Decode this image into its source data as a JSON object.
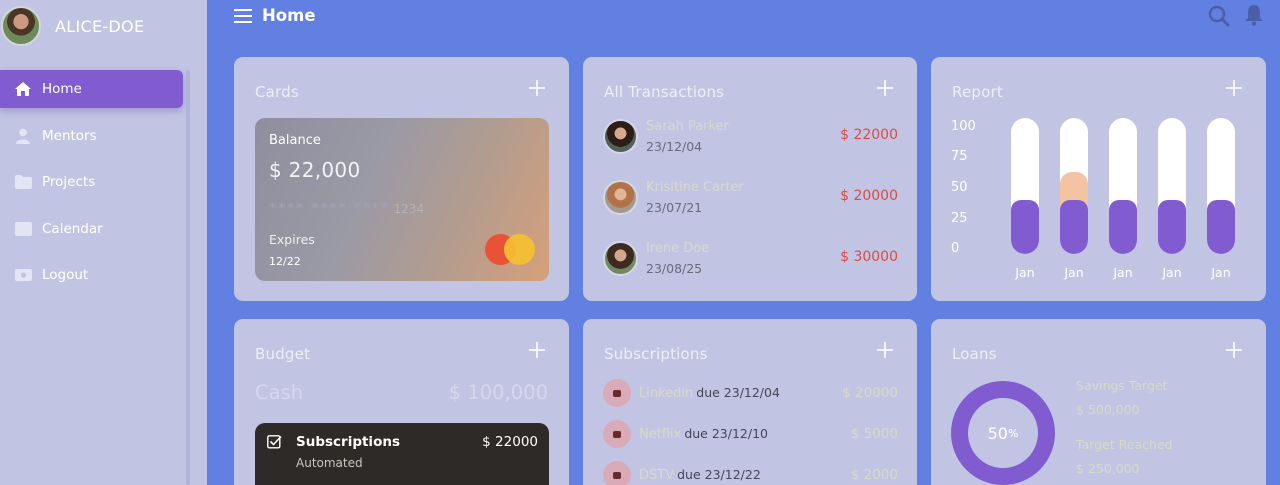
{
  "profile": {
    "username": "ALICE-DOE"
  },
  "nav": [
    {
      "label": "Home",
      "icon": "home-icon",
      "active": true
    },
    {
      "label": "Mentors",
      "icon": "user-icon"
    },
    {
      "label": "Projects",
      "icon": "folder-icon"
    },
    {
      "label": "Calendar",
      "icon": "calendar-icon"
    },
    {
      "label": "Logout",
      "icon": "logout-icon"
    }
  ],
  "topbar": {
    "title": "Home"
  },
  "cards_panel": {
    "title": "Cards",
    "balance_label": "Balance",
    "balance_value": "$ 22,000",
    "masked_number": "**** **** ****",
    "last_digits": "1234",
    "expires_label": "Expires",
    "expires_value": "12/22"
  },
  "transactions_panel": {
    "title": "All Transactions",
    "items": [
      {
        "name": "Sarah Parker",
        "date": "23/12/04",
        "amount": "$ 22000"
      },
      {
        "name": "Krisitine Carter",
        "date": "23/07/21",
        "amount": "$ 20000"
      },
      {
        "name": "Irene Doe",
        "date": "23/08/25",
        "amount": "$ 30000"
      }
    ]
  },
  "report_panel": {
    "title": "Report",
    "chart_data": {
      "type": "bar",
      "y_ticks": [
        "100",
        "75",
        "50",
        "25",
        "0"
      ],
      "categories": [
        "Jan",
        "Jan",
        "Jan",
        "Jan",
        "Jan"
      ],
      "values": [
        40,
        40,
        40,
        40,
        40
      ],
      "highlight_values": [
        0,
        60,
        0,
        0,
        0
      ],
      "ylim": [
        0,
        100
      ],
      "colors": {
        "fill": "#805cd0",
        "highlight": "#f3c3a4",
        "track": "#ffffff"
      }
    }
  },
  "budget_panel": {
    "title": "Budget",
    "cash_label": "Cash",
    "cash_value": "$ 100,000",
    "sub_title": "Subscriptions",
    "sub_amount": "$ 22000",
    "sub_status": "Automated"
  },
  "subscriptions_panel": {
    "title": "Subscriptions",
    "items": [
      {
        "name": "Linkedin",
        "due": "due 23/12/04",
        "amount": "$ 20000"
      },
      {
        "name": "Netflix",
        "due": "due 23/12/10",
        "amount": "$ 5000"
      },
      {
        "name": "DSTV",
        "due": "due 23/12/22",
        "amount": "$ 2000"
      }
    ]
  },
  "loans_panel": {
    "title": "Loans",
    "percent": "50",
    "percent_sign": "%",
    "savings_label": "Savings Target",
    "savings_value": "$ 500,000",
    "reached_label": "Target Reached",
    "reached_value": "$ 250,000"
  },
  "colors": {
    "accent": "#805cd0",
    "background": "#6180e2",
    "panel": "#c1c5e3",
    "negative": "#e04a42"
  }
}
